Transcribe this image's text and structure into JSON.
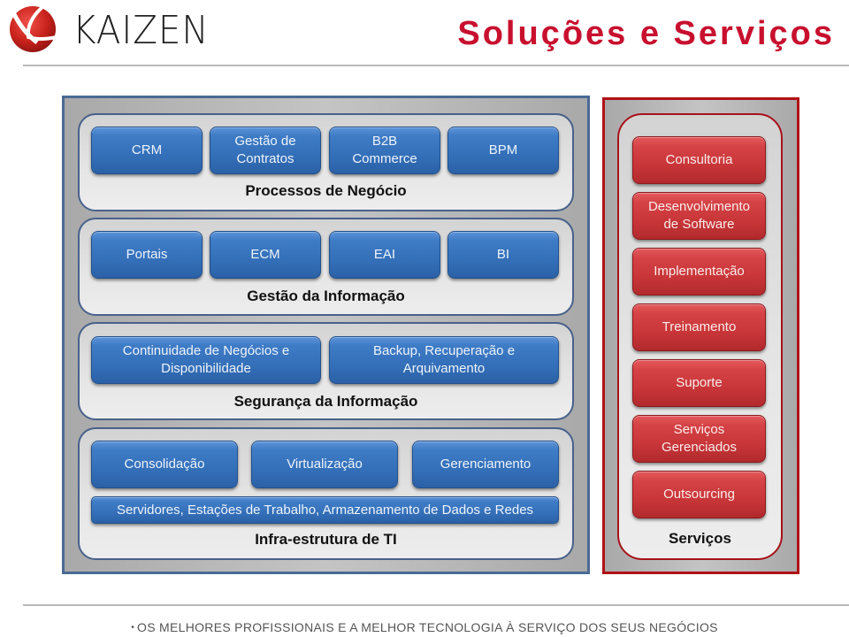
{
  "header": {
    "brand": "KAIZEN",
    "title": "Soluções e Serviços",
    "colors": {
      "title": "#c8102e",
      "blue_button": "#3470b9",
      "red_button": "#c93639"
    }
  },
  "solutions": {
    "processos": {
      "label": "Processos de Negócio",
      "items": [
        {
          "label": "CRM"
        },
        {
          "label": "Gestão de Contratos"
        },
        {
          "label": "B2B Commerce"
        },
        {
          "label": "BPM"
        }
      ]
    },
    "gestao": {
      "label": "Gestão da Informação",
      "items": [
        {
          "label": "Portais"
        },
        {
          "label": "ECM"
        },
        {
          "label": "EAI"
        },
        {
          "label": "BI"
        }
      ]
    },
    "seguranca": {
      "label": "Segurança da Informação",
      "items": [
        {
          "label": "Continuidade de Negócios e Disponibilidade"
        },
        {
          "label": "Backup, Recuperação e Arquivamento"
        }
      ]
    },
    "infra": {
      "label": "Infra-estrutura de TI",
      "items": [
        {
          "label": "Consolidação"
        },
        {
          "label": "Virtualização"
        },
        {
          "label": "Gerenciamento"
        }
      ],
      "bar": "Servidores, Estações de Trabalho, Armazenamento de Dados e Redes"
    }
  },
  "services": {
    "label": "Serviços",
    "items": [
      {
        "label": "Consultoria"
      },
      {
        "label": "Desenvolvimento de Software"
      },
      {
        "label": "Implementação"
      },
      {
        "label": "Treinamento"
      },
      {
        "label": "Suporte"
      },
      {
        "label": "Serviços Gerenciados"
      },
      {
        "label": "Outsourcing"
      }
    ]
  },
  "footer": {
    "bullet": "•",
    "text": "OS MELHORES PROFISSIONAIS E A MELHOR TECNOLOGIA À SERVIÇO DOS SEUS NEGÓCIOS"
  }
}
